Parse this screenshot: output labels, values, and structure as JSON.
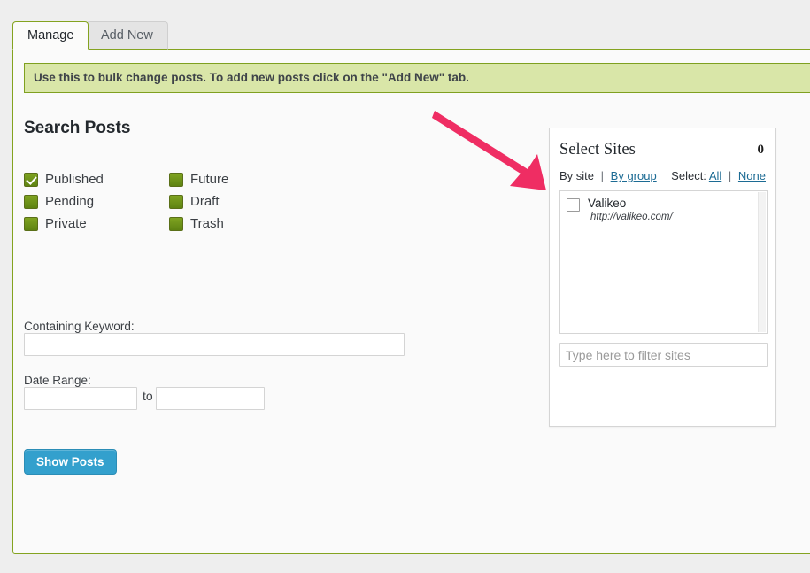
{
  "tabs": [
    {
      "label": "Manage",
      "active": true
    },
    {
      "label": "Add New",
      "active": false
    }
  ],
  "notice": {
    "text": "Use this to bulk change posts. To add new posts click on the \"Add New\" tab.",
    "background_color": "#d9e6a8",
    "border_color": "#7fa020"
  },
  "search_posts": {
    "heading": "Search Posts",
    "statuses": [
      {
        "label": "Published",
        "checked": true,
        "column": 1
      },
      {
        "label": "Future",
        "checked": false,
        "column": 2
      },
      {
        "label": "Pending",
        "checked": false,
        "column": 1
      },
      {
        "label": "Draft",
        "checked": false,
        "column": 2
      },
      {
        "label": "Private",
        "checked": false,
        "column": 1
      },
      {
        "label": "Trash",
        "checked": false,
        "column": 2
      }
    ],
    "keyword": {
      "label": "Containing Keyword:",
      "value": "",
      "placeholder": ""
    },
    "date_range": {
      "label": "Date Range:",
      "from_value": "",
      "to_separator": "to",
      "to_value": ""
    },
    "submit_label": "Show Posts",
    "submit_color": "#33a0cd"
  },
  "select_sites": {
    "title": "Select Sites",
    "selected_count": "0",
    "view_by_site": "By site",
    "view_by_group": "By group",
    "separator": "|",
    "select_label": "Select:",
    "select_all": "All",
    "select_none": "None",
    "filter_placeholder": "Type here to filter sites",
    "filter_value": "",
    "sites": [
      {
        "name": "Valikeo",
        "url": "http://valikeo.com/",
        "checked": false
      }
    ]
  },
  "annotation": {
    "type": "arrow",
    "color": "#ef2d63",
    "points_to": "select-sites-panel"
  }
}
